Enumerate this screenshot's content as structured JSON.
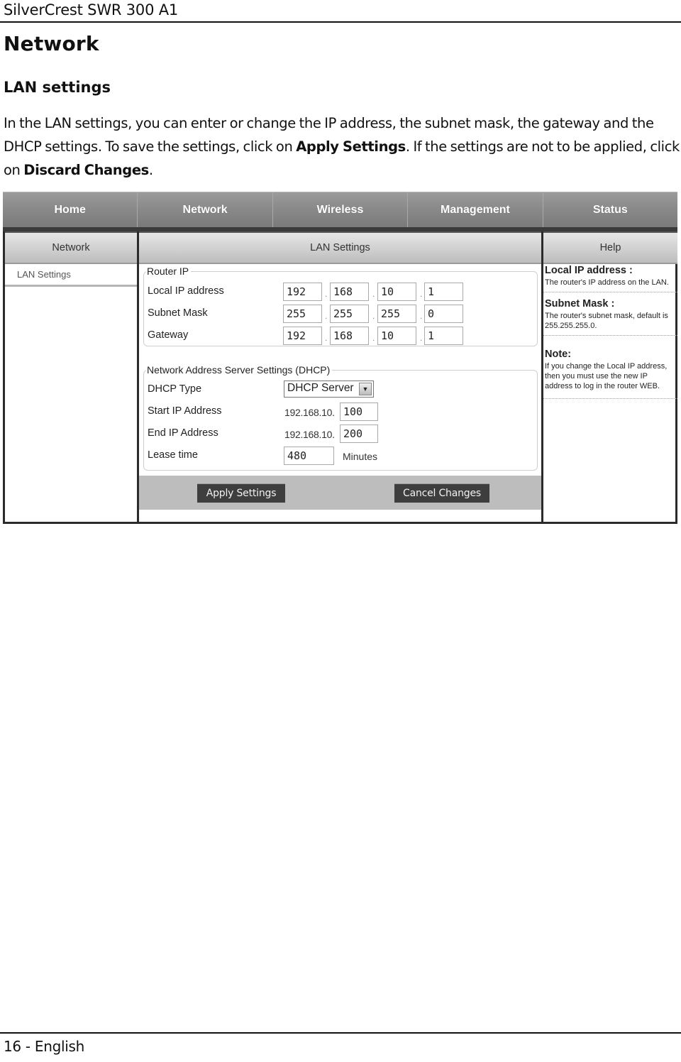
{
  "document": {
    "header": "SilverCrest SWR 300 A1",
    "title": "Network",
    "subtitle": "LAN settings",
    "paragraph": {
      "part1": "In the LAN settings, you can enter or change the IP address, the subnet mask, the gateway and the DHCP settings. To save the settings, click on ",
      "bold1": "Apply Settings",
      "part2": ". If the settings are not to be applied, click on ",
      "bold2": "Discard Changes",
      "part3": "."
    },
    "footer": "16 - English"
  },
  "router_ui": {
    "top_nav": [
      "Home",
      "Network",
      "Wireless",
      "Management",
      "Status"
    ],
    "left_panel": {
      "header": "Network",
      "items": [
        "LAN Settings"
      ]
    },
    "main_panel": {
      "header": "LAN Settings",
      "router_ip": {
        "legend": "Router IP",
        "rows": [
          {
            "label": "Local IP address",
            "octets": [
              "192",
              "168",
              "10",
              "1"
            ]
          },
          {
            "label": "Subnet Mask",
            "octets": [
              "255",
              "255",
              "255",
              "0"
            ]
          },
          {
            "label": "Gateway",
            "octets": [
              "192",
              "168",
              "10",
              "1"
            ]
          }
        ]
      },
      "dhcp": {
        "legend": "Network Address Server Settings (DHCP)",
        "type_label": "DHCP Type",
        "type_value": "DHCP Server",
        "start_label": "Start IP Address",
        "start_prefix": "192.168.10.",
        "start_value": "100",
        "end_label": "End IP Address",
        "end_prefix": "192.168.10.",
        "end_value": "200",
        "lease_label": "Lease time",
        "lease_value": "480",
        "lease_unit": "Minutes"
      },
      "buttons": {
        "apply": "Apply Settings",
        "cancel": "Cancel Changes"
      }
    },
    "help_panel": {
      "header": "Help",
      "sections": [
        {
          "title": "Local IP address :",
          "text": "The router's IP address on the LAN."
        },
        {
          "title": "Subnet Mask :",
          "text": "The router's subnet mask, default is 255.255.255.0."
        },
        {
          "title": "Note:",
          "text": "If you change the Local IP address, then you must use the new IP address to log in the router WEB."
        }
      ]
    }
  }
}
